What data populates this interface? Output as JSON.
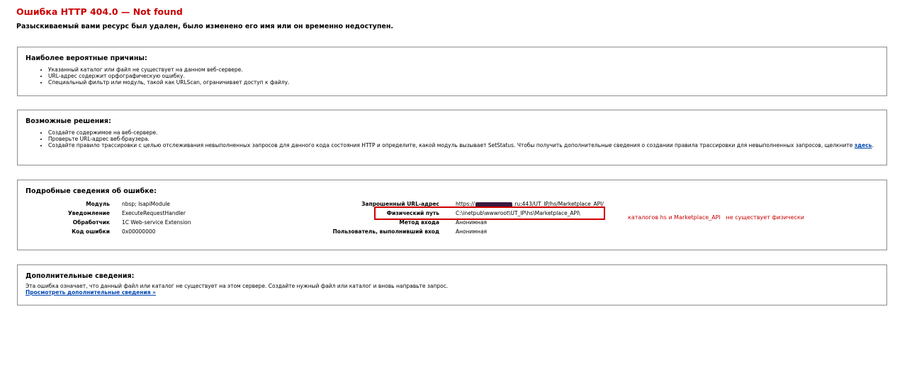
{
  "header": {
    "title": "Ошибка HTTP 404.0 — Not found",
    "subtitle": "Разыскиваемый вами ресурс был удален, было изменено его имя или он временно недоступен."
  },
  "causes": {
    "heading": "Наиболее вероятные причины:",
    "items": [
      "Указанный каталог или файл не существует на данном веб-сервере.",
      "URL-адрес содержит орфографическую ошибку.",
      "Специальный фильтр или модуль, такой как URLScan, ограничивает доступ к файлу."
    ]
  },
  "solutions": {
    "heading": "Возможные решения:",
    "items": [
      "Создайте содержимое на веб-сервере.",
      "Проверьте URL-адрес веб-браузера.",
      "Создайте правило трассировки с целью отслеживания невыполненных запросов для данного кода состояния HTTP и определите, какой модуль вызывает SetStatus. Чтобы получить дополнительные сведения о создании правила трассировки для невыполненных запросов, щелкните"
    ],
    "link_text": "здесь"
  },
  "details": {
    "heading": "Подробные сведения об ошибке:",
    "left": [
      {
        "label": "Модуль",
        "value": "nbsp;  IsapiModule"
      },
      {
        "label": "Уведомление",
        "value": "ExecuteRequestHandler"
      },
      {
        "label": "Обработчик",
        "value": "1C Web-service Extension"
      },
      {
        "label": "Код ошибки",
        "value": "0x00000000"
      }
    ],
    "right": {
      "url_label": "Запрошенный URL-адрес",
      "url_prefix": "https://",
      "url_suffix": ".ru:443/UT_IP/hs/Marketplace_API/",
      "path_label": "Физический путь",
      "path_value": "C:\\inetpub\\wwwroot\\UT_IP\\hs\\Marketplace_API\\",
      "logon_label": "Метод входа",
      "logon_value": "Анонимная",
      "user_label": "Пользователь, выполнивший вход",
      "user_value": "Анонимная"
    }
  },
  "annotation": "каталогов hs и Marketplace_API   не существует физически",
  "more_info": {
    "heading": "Дополнительные сведения:",
    "text": "Эта ошибка означает, что данный файл или каталог не существует на этом сервере. Создайте нужный файл или каталог и вновь направьте запрос.",
    "link": "Просмотреть дополнительные сведения »"
  },
  "colors": {
    "title_red": "#CC0000",
    "annotation_red": "#c60000",
    "link_blue": "#0047b3"
  }
}
